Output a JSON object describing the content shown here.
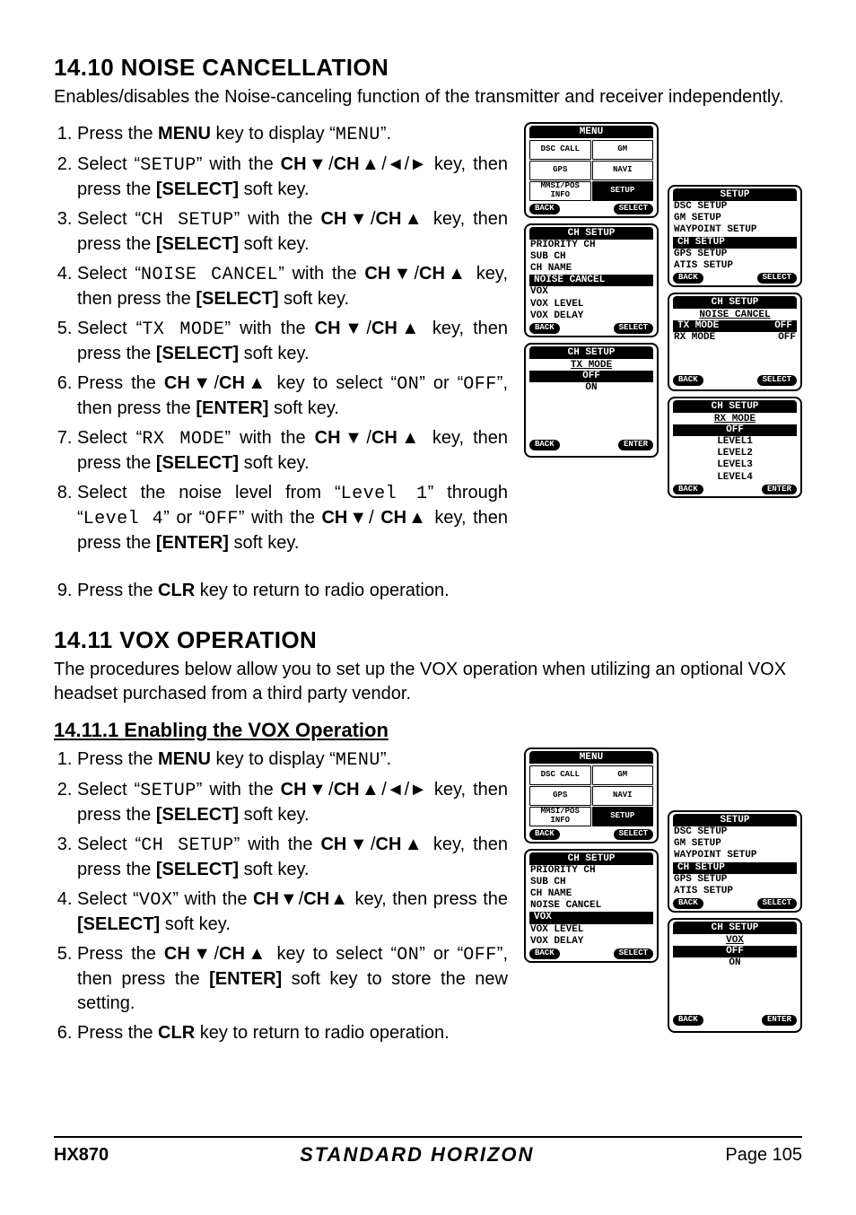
{
  "section1": {
    "heading": "14.10 NOISE CANCELLATION",
    "intro": "Enables/disables the Noise-canceling function of the transmitter and receiver independently.",
    "step9": "Press the CLR key to return to radio operation."
  },
  "section2": {
    "heading": "14.11 VOX OPERATION",
    "intro": "The procedures below allow you to set up the VOX operation when utilizing an optional VOX headset purchased from a third party vendor.",
    "sub_heading": "14.11.1  Enabling the VOX Operation"
  },
  "keys": {
    "MENU": "MENU",
    "CHdown": "CH▼",
    "CHup": "CH▲",
    "left": "◄",
    "right": "►",
    "SELECT": "[SELECT]",
    "ENTER": "[ENTER]",
    "CLR": "CLR"
  },
  "mono": {
    "MENU": "MENU",
    "SETUP": "SETUP",
    "CH_SETUP": "CH SETUP",
    "NOISE_CANCEL": "NOISE CANCEL",
    "TX_MODE": "TX MODE",
    "RX_MODE": "RX MODE",
    "ON": "ON",
    "OFF": "OFF",
    "VOX": "VOX",
    "Level1": "Level 1",
    "Level4": "Level 4"
  },
  "screens": {
    "menu_title": "MENU",
    "menu_items": [
      "DSC CALL",
      "GM",
      "GPS",
      "NAVI",
      "MMSI/POS INFO",
      "SETUP"
    ],
    "menu_back": "BACK",
    "menu_select": "SELECT",
    "setup_title": "SETUP",
    "setup_items": [
      "DSC SETUP",
      "GM SETUP",
      "WAYPOINT SETUP",
      "CH SETUP",
      "GPS SETUP",
      "ATIS SETUP"
    ],
    "setup_back": "BACK",
    "setup_select": "SELECT",
    "chsetup_title": "CH SETUP",
    "chsetup_items_a": [
      "PRIORITY CH",
      "SUB CH",
      "CH NAME",
      "NOISE CANCEL",
      "VOX",
      "VOX LEVEL",
      "VOX DELAY"
    ],
    "chsetup_back": "BACK",
    "chsetup_select": "SELECT",
    "noise_title": "CH SETUP",
    "noise_sub": "NOISE CANCEL",
    "noise_tx": "TX MODE",
    "noise_tx_val": "OFF",
    "noise_rx": "RX MODE",
    "noise_rx_val": "OFF",
    "tx_title": "CH SETUP",
    "tx_sub": "TX MODE",
    "tx_items": [
      "OFF",
      "ON"
    ],
    "tx_back": "BACK",
    "tx_enter": "ENTER",
    "rx_title": "CH SETUP",
    "rx_sub": "RX MODE",
    "rx_items": [
      "OFF",
      "LEVEL1",
      "LEVEL2",
      "LEVEL3",
      "LEVEL4"
    ],
    "rx_back": "BACK",
    "rx_enter": "ENTER",
    "vox_title": "CH SETUP",
    "vox_sub": "VOX",
    "vox_items": [
      "OFF",
      "ON"
    ],
    "vox_back": "BACK",
    "vox_enter": "ENTER",
    "chsetup_vox_highlight": "VOX"
  },
  "footer": {
    "model": "HX870",
    "brand": "STANDARD HORIZON",
    "page": "Page 105"
  }
}
